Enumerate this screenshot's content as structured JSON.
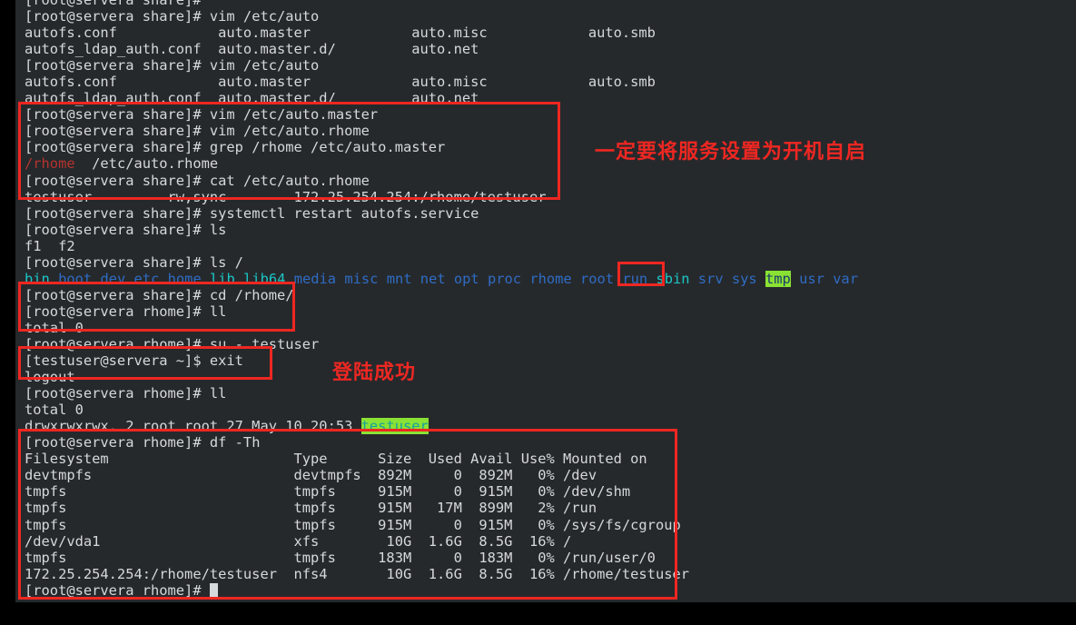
{
  "theme": {
    "terminal_bg": "#26292c",
    "page_bg": "#000000",
    "foreground": "#d6d9db",
    "annotation_red": "#ee2722",
    "dir_blue": "#2f6cc4",
    "link_cyan": "#1cc7c7",
    "match_red": "#b5332e",
    "sticky_green_bg": "#8ae234"
  },
  "terminal": {
    "hostname": "servera",
    "user_root": "root",
    "user_test": "testuser",
    "prompt_share": "[root@servera share]#",
    "prompt_rhome": "[root@servera rhome]#",
    "prompt_testuser": "[testuser@servera ~]$",
    "lines": [
      {
        "id": "l00",
        "type": "prompt_partial",
        "prompt": "[root@servera share]#",
        "text": ""
      },
      {
        "id": "l01",
        "type": "prompt",
        "prompt": "[root@servera share]#",
        "command": " vim /etc/auto"
      },
      {
        "id": "l02",
        "type": "plain",
        "text": "autofs.conf            auto.master            auto.misc            auto.smb"
      },
      {
        "id": "l03",
        "type": "plain",
        "text": "autofs_ldap_auth.conf  auto.master.d/         auto.net"
      },
      {
        "id": "l04",
        "type": "prompt",
        "prompt": "[root@servera share]#",
        "command": " vim /etc/auto"
      },
      {
        "id": "l05",
        "type": "plain",
        "text": "autofs.conf            auto.master            auto.misc            auto.smb"
      },
      {
        "id": "l06",
        "type": "plain",
        "text": "autofs_ldap_auth.conf  auto.master.d/         auto.net"
      },
      {
        "id": "l07",
        "type": "prompt",
        "prompt": "[root@servera share]#",
        "command": " vim /etc/auto.master"
      },
      {
        "id": "l08",
        "type": "prompt",
        "prompt": "[root@servera share]#",
        "command": " vim /etc/auto.rhome"
      },
      {
        "id": "l09",
        "type": "prompt",
        "prompt": "[root@servera share]#",
        "command": " grep /rhome /etc/auto.master"
      },
      {
        "id": "l10",
        "type": "grep_hit",
        "match": "/rhome",
        "rest": "  /etc/auto.rhome"
      },
      {
        "id": "l11",
        "type": "prompt",
        "prompt": "[root@servera share]#",
        "command": " cat /etc/auto.rhome"
      },
      {
        "id": "l12",
        "type": "plain",
        "text": "testuser        -rw,sync        172.25.254.254:/rhome/testuser"
      },
      {
        "id": "l13",
        "type": "prompt",
        "prompt": "[root@servera share]#",
        "command": " systemctl restart autofs.service"
      },
      {
        "id": "l14",
        "type": "prompt",
        "prompt": "[root@servera share]#",
        "command": " ls"
      },
      {
        "id": "l15",
        "type": "plain",
        "text": "f1  f2"
      },
      {
        "id": "l16",
        "type": "prompt",
        "prompt": "[root@servera share]#",
        "command": " ls /"
      },
      {
        "id": "l17",
        "type": "ls_root"
      },
      {
        "id": "l18",
        "type": "prompt",
        "prompt": "[root@servera share]#",
        "command": " cd /rhome/"
      },
      {
        "id": "l19",
        "type": "prompt",
        "prompt": "[root@servera rhome]#",
        "command": " ll"
      },
      {
        "id": "l20",
        "type": "plain",
        "text": "total 0"
      },
      {
        "id": "l21",
        "type": "prompt",
        "prompt": "[root@servera rhome]#",
        "command": " su - testuser"
      },
      {
        "id": "l22",
        "type": "prompt",
        "prompt": "[testuser@servera ~]$",
        "command": " exit"
      },
      {
        "id": "l23",
        "type": "plain",
        "text": "logout"
      },
      {
        "id": "l24",
        "type": "prompt",
        "prompt": "[root@servera rhome]#",
        "command": " ll"
      },
      {
        "id": "l25",
        "type": "plain",
        "text": "total 0"
      },
      {
        "id": "l26",
        "type": "ll_entry",
        "prefix": "drwxrwxrwx. 2 root root 27 May 10 20:53 ",
        "name": "testuser"
      },
      {
        "id": "l27",
        "type": "prompt",
        "prompt": "[root@servera rhome]#",
        "command": " df -Th"
      },
      {
        "id": "l28",
        "type": "plain",
        "text": "Filesystem                      Type      Size  Used Avail Use% Mounted on"
      },
      {
        "id": "l29",
        "type": "plain",
        "text": "devtmpfs                        devtmpfs  892M     0  892M   0% /dev"
      },
      {
        "id": "l30",
        "type": "plain",
        "text": "tmpfs                           tmpfs     915M     0  915M   0% /dev/shm"
      },
      {
        "id": "l31",
        "type": "plain",
        "text": "tmpfs                           tmpfs     915M   17M  899M   2% /run"
      },
      {
        "id": "l32",
        "type": "plain",
        "text": "tmpfs                           tmpfs     915M     0  915M   0% /sys/fs/cgroup"
      },
      {
        "id": "l33",
        "type": "plain",
        "text": "/dev/vda1                       xfs        10G  1.6G  8.5G  16% /"
      },
      {
        "id": "l34",
        "type": "plain",
        "text": "tmpfs                           tmpfs     183M     0  183M   0% /run/user/0"
      },
      {
        "id": "l35",
        "type": "plain",
        "text": "172.25.254.254:/rhome/testuser  nfs4       10G  1.6G  8.5G  16% /rhome/testuser"
      },
      {
        "id": "l36",
        "type": "prompt_cursor",
        "prompt": "[root@servera rhome]#",
        "command": " "
      }
    ],
    "ls_root_entries": [
      {
        "name": "bin",
        "kind": "symlink"
      },
      {
        "name": "boot",
        "kind": "dir"
      },
      {
        "name": "dev",
        "kind": "dir"
      },
      {
        "name": "etc",
        "kind": "dir"
      },
      {
        "name": "home",
        "kind": "dir"
      },
      {
        "name": "lib",
        "kind": "symlink"
      },
      {
        "name": "lib64",
        "kind": "symlink"
      },
      {
        "name": "media",
        "kind": "dir"
      },
      {
        "name": "misc",
        "kind": "dir"
      },
      {
        "name": "mnt",
        "kind": "dir"
      },
      {
        "name": "net",
        "kind": "dir"
      },
      {
        "name": "opt",
        "kind": "dir"
      },
      {
        "name": "proc",
        "kind": "dir"
      },
      {
        "name": "rhome",
        "kind": "dir"
      },
      {
        "name": "root",
        "kind": "dir"
      },
      {
        "name": "run",
        "kind": "dir"
      },
      {
        "name": "sbin",
        "kind": "symlink"
      },
      {
        "name": "srv",
        "kind": "dir"
      },
      {
        "name": "sys",
        "kind": "dir"
      },
      {
        "name": "tmp",
        "kind": "sticky"
      },
      {
        "name": "usr",
        "kind": "dir"
      },
      {
        "name": "var",
        "kind": "dir"
      }
    ],
    "df_table": {
      "headers": [
        "Filesystem",
        "Type",
        "Size",
        "Used",
        "Avail",
        "Use%",
        "Mounted on"
      ],
      "rows": [
        [
          "devtmpfs",
          "devtmpfs",
          "892M",
          "0",
          "892M",
          "0%",
          "/dev"
        ],
        [
          "tmpfs",
          "tmpfs",
          "915M",
          "0",
          "915M",
          "0%",
          "/dev/shm"
        ],
        [
          "tmpfs",
          "tmpfs",
          "915M",
          "17M",
          "899M",
          "2%",
          "/run"
        ],
        [
          "tmpfs",
          "tmpfs",
          "915M",
          "0",
          "915M",
          "0%",
          "/sys/fs/cgroup"
        ],
        [
          "/dev/vda1",
          "xfs",
          "10G",
          "1.6G",
          "8.5G",
          "16%",
          "/"
        ],
        [
          "tmpfs",
          "tmpfs",
          "183M",
          "0",
          "183M",
          "0%",
          "/run/user/0"
        ],
        [
          "172.25.254.254:/rhome/testuser",
          "nfs4",
          "10G",
          "1.6G",
          "8.5G",
          "16%",
          "/rhome/testuser"
        ]
      ]
    }
  },
  "annotations": {
    "note_autostart": "一定要将服务设置为开机自启",
    "note_login_success": "登陆成功",
    "boxes": [
      {
        "id": "box-auto",
        "label": "autofs-config-highlight"
      },
      {
        "id": "box-rhome-ls",
        "label": "rhome-directory-highlight"
      },
      {
        "id": "box-cd",
        "label": "cd-rhome-highlight"
      },
      {
        "id": "box-su",
        "label": "su-testuser-highlight"
      },
      {
        "id": "box-df",
        "label": "df-output-highlight"
      }
    ]
  }
}
